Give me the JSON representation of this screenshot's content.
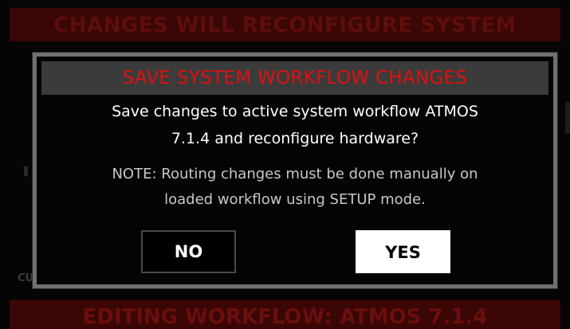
{
  "background": {
    "top_banner": "CHANGES WILL RECONFIGURE SYSTEM",
    "bottom_banner": "EDITING WORKFLOW: ATMOS 7.1.4",
    "left_fragment": "CU"
  },
  "dialog": {
    "title": "SAVE SYSTEM WORKFLOW CHANGES",
    "question_line1": "Save changes to active system workflow ATMOS",
    "question_line2": "7.1.4 and reconfigure hardware?",
    "note_line1": "NOTE: Routing changes must be done manually on",
    "note_line2": "loaded workflow using SETUP mode.",
    "no_label": "NO",
    "yes_label": "YES"
  },
  "colors": {
    "title_text": "#e01010",
    "title_bar": "#3b3b3b",
    "dialog_border": "#707070",
    "banner_bg": "#3a0606"
  }
}
